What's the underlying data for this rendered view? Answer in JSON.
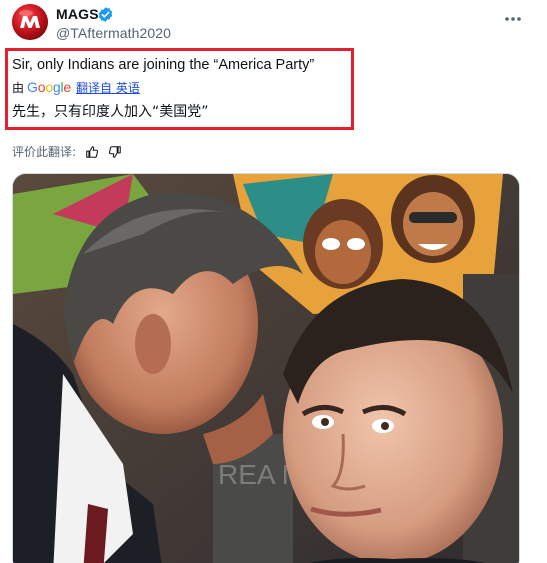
{
  "post": {
    "author_name": "MAGS",
    "handle": "@TAftermath2020",
    "verified": true,
    "text": "Sir, only Indians are joining the “America Party”",
    "translation": {
      "by_prefix": "由",
      "provider": "Google",
      "link_label": "翻译自 英语",
      "text": "先生，只有印度人加入“美国党”"
    },
    "feedback_label": "评价此翻译:",
    "highlight_color": "#e5202e"
  },
  "icons": {
    "avatar": "avatar-logo",
    "verified": "verified-badge-icon",
    "more": "more-options-icon",
    "thumbs_up": "thumbs-up-icon",
    "thumbs_down": "thumbs-down-icon"
  },
  "media": {
    "description_hidden": true,
    "painting_text": "REA M"
  }
}
